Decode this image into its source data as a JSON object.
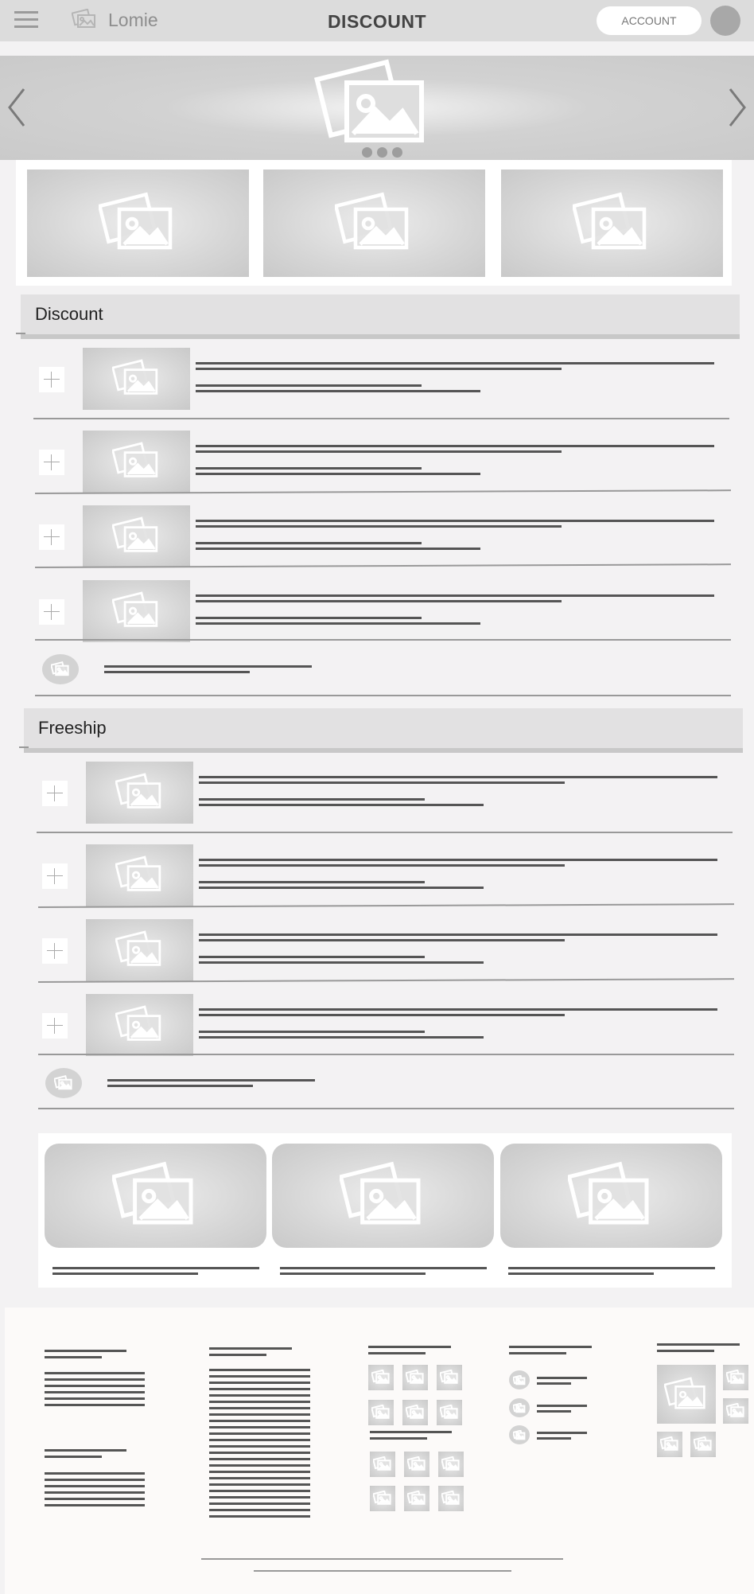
{
  "header": {
    "brand": "Lomie",
    "title": "DISCOUNT",
    "account_label": "ACCOUNT",
    "icons": [
      "menu-icon",
      "image-icon",
      "avatar"
    ]
  },
  "hero": {
    "slide_count": 3,
    "icons": [
      "chevron-left-icon",
      "chevron-right-icon",
      "image-icon"
    ]
  },
  "sections": [
    {
      "id": "discount",
      "title": "Discount"
    },
    {
      "id": "freeship",
      "title": "Freeship"
    }
  ],
  "colors": {
    "header_bg": "#dcdcdc",
    "page_bg": "#f3f2f3",
    "placeholder": "#d6d6d6",
    "line": "#555555",
    "section_bar": "#e2e1e2"
  }
}
